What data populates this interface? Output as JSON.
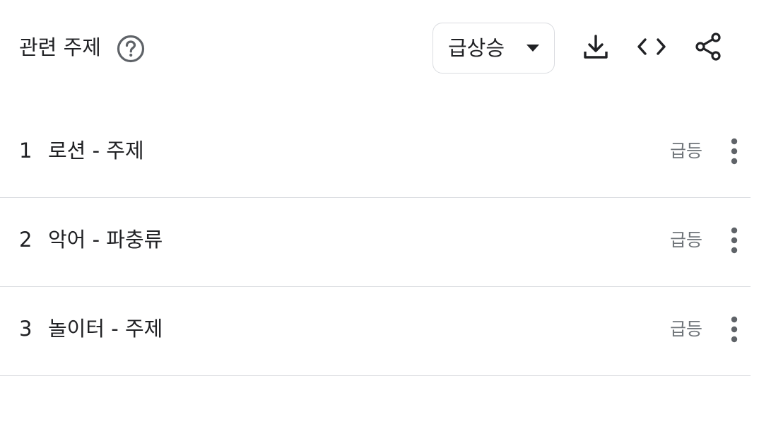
{
  "header": {
    "title": "관련 주제",
    "help_icon": "help-circle-icon",
    "select_value": "급상승",
    "select_caret_icon": "caret-down-icon",
    "download_icon": "download-icon",
    "embed_icon": "code-embed-icon",
    "share_icon": "share-icon"
  },
  "list": {
    "items": [
      {
        "rank": "1",
        "label": "로션 - 주제",
        "status": "급등",
        "menu_icon": "more-vert-icon"
      },
      {
        "rank": "2",
        "label": "악어 - 파충류",
        "status": "급등",
        "menu_icon": "more-vert-icon"
      },
      {
        "rank": "3",
        "label": "놀이터 - 주제",
        "status": "급등",
        "menu_icon": "more-vert-icon"
      }
    ]
  },
  "colors": {
    "text": "#202124",
    "secondary_text": "#70757a",
    "icon": "#5f6368",
    "divider": "#dadce0"
  }
}
